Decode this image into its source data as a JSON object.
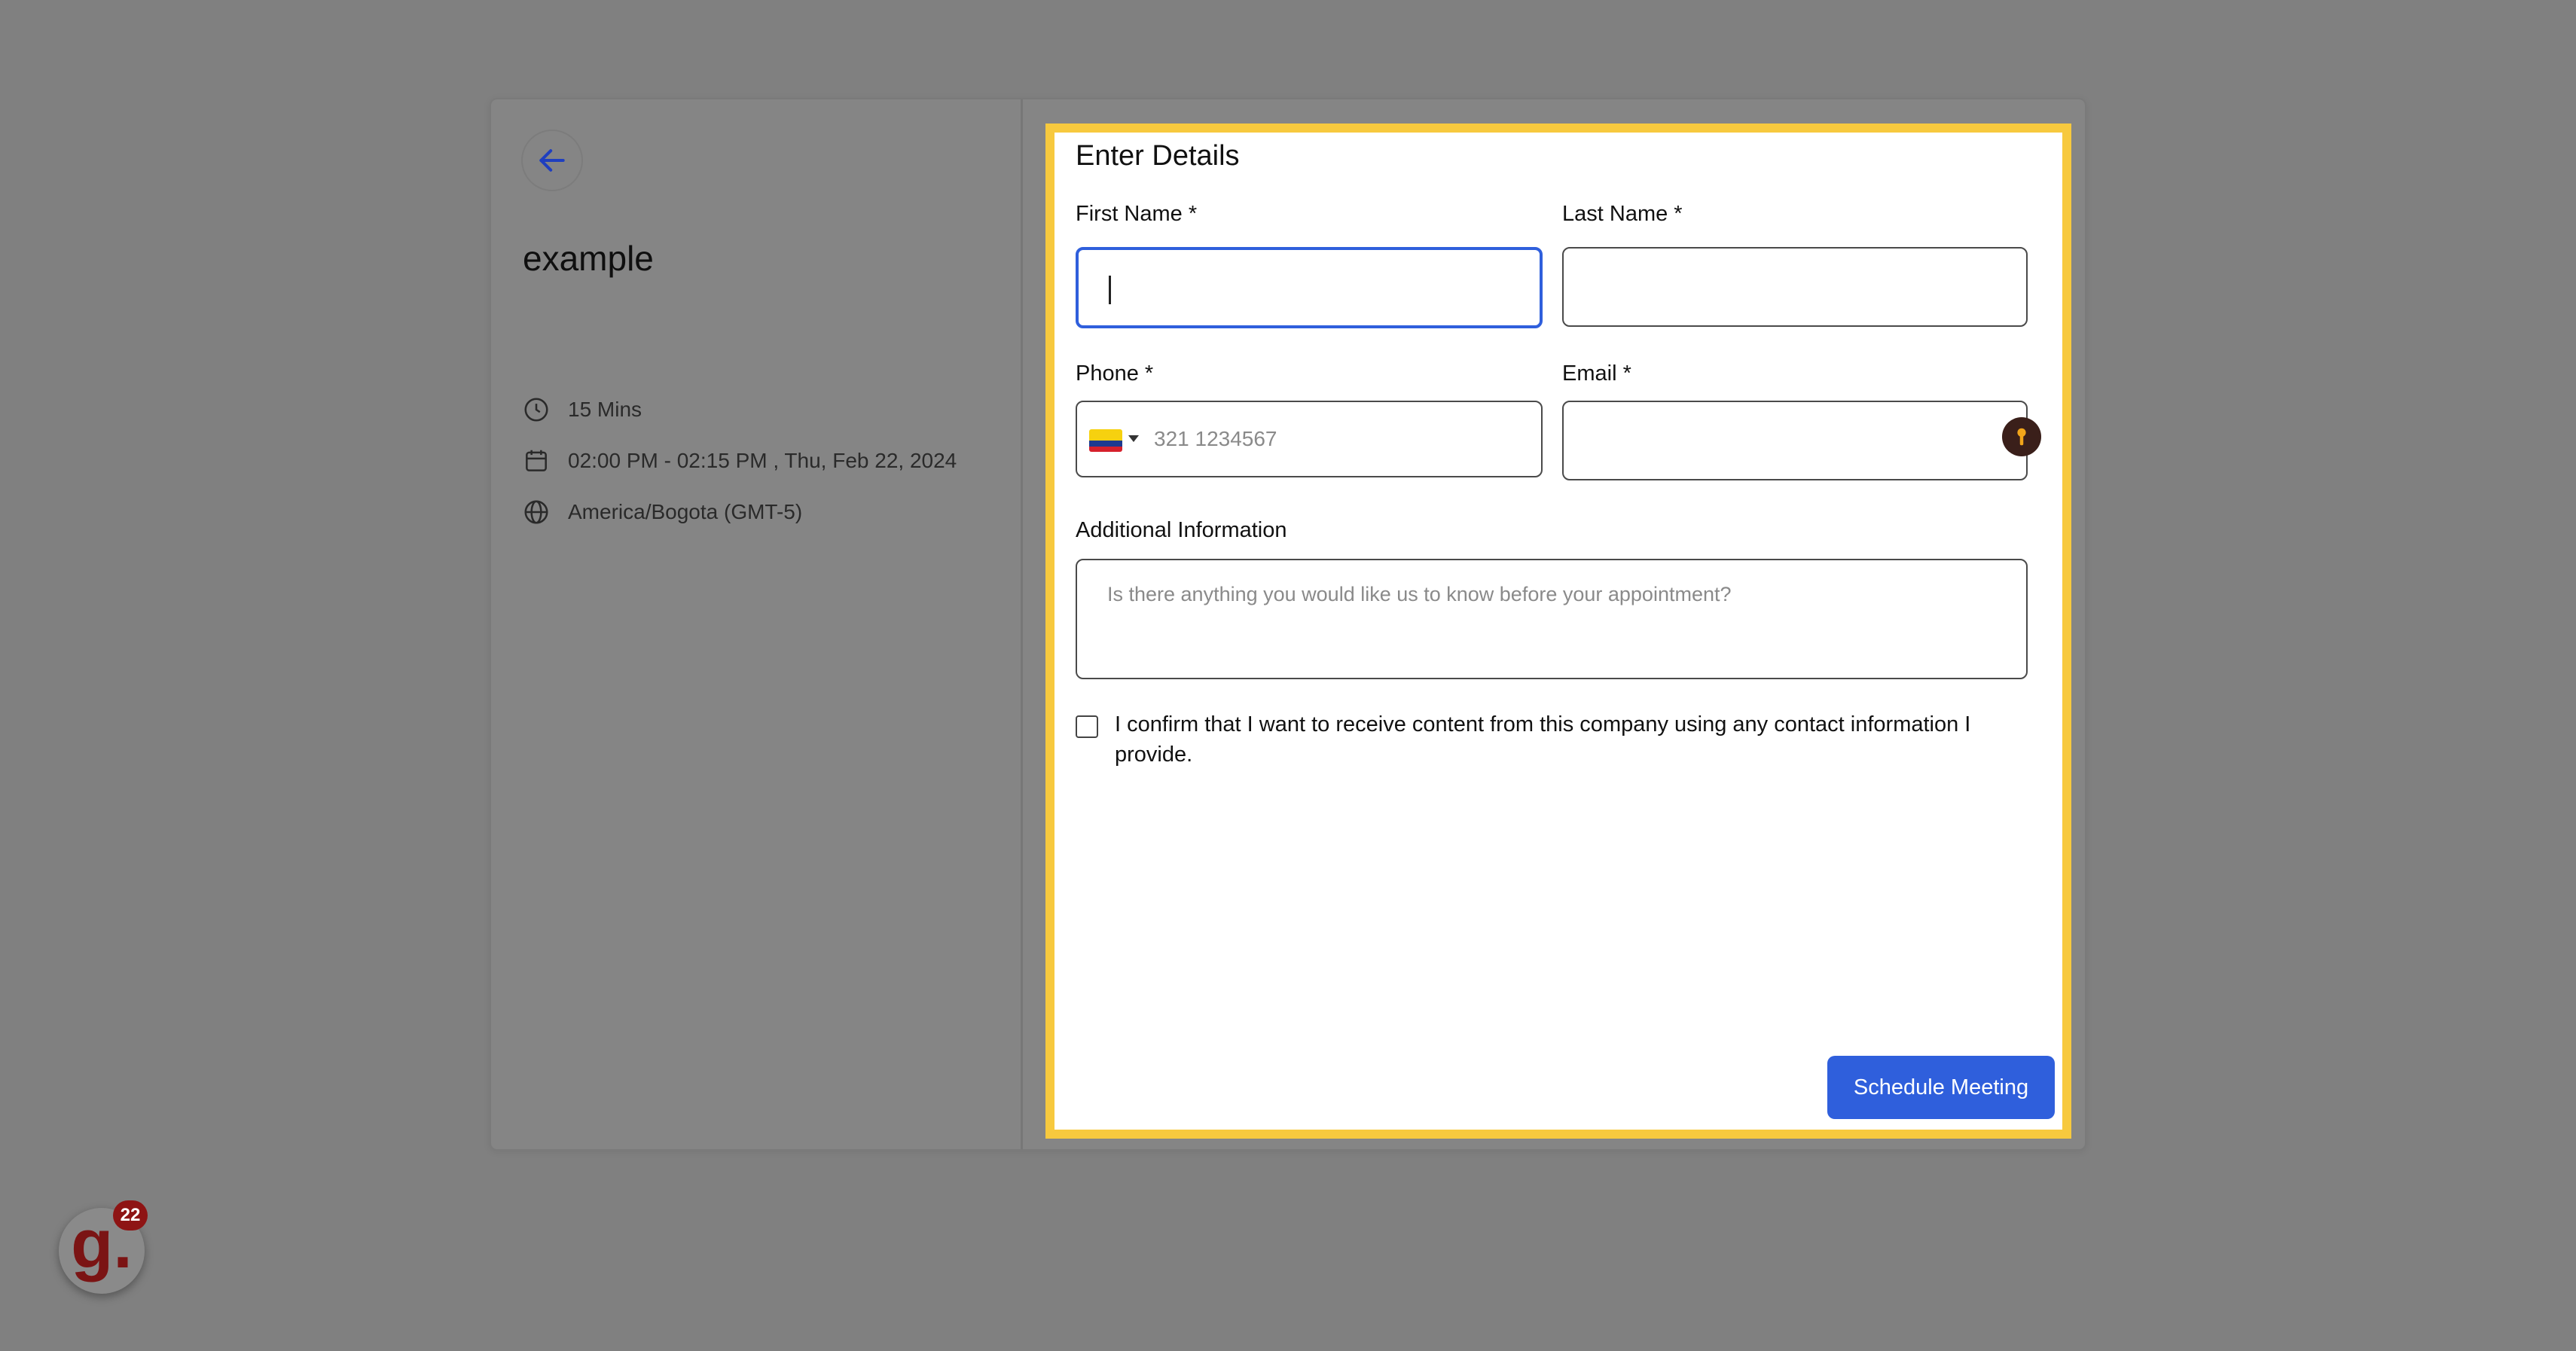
{
  "event": {
    "title": "example",
    "duration": "15 Mins",
    "datetime": "02:00 PM - 02:15 PM , Thu, Feb 22, 2024",
    "timezone": "America/Bogota (GMT-5)"
  },
  "form": {
    "heading": "Enter Details",
    "first_name_label": "First Name *",
    "first_name_value": "",
    "last_name_label": "Last Name *",
    "last_name_value": "",
    "phone_label": "Phone *",
    "phone_placeholder": "321 1234567",
    "phone_country_icon": "colombia-flag-icon",
    "email_label": "Email *",
    "email_value": "",
    "additional_label": "Additional Information",
    "additional_placeholder": "Is there anything you would like us to know before your appointment?",
    "consent_text": "I confirm that I want to receive content from this company using any contact information I provide.",
    "consent_checked": false,
    "submit_label": "Schedule Meeting"
  },
  "widget": {
    "letter": "g.",
    "badge_count": "22"
  },
  "colors": {
    "accent": "#2f5fdc",
    "highlight": "#f7c93e",
    "overlay": "#808080",
    "widget_brand": "#8e1414"
  }
}
